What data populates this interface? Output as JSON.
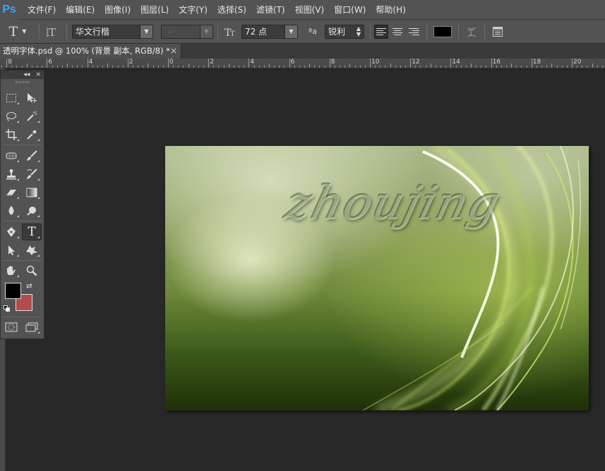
{
  "app": {
    "logo": "Ps"
  },
  "menu": [
    "文件(F)",
    "编辑(E)",
    "图像(I)",
    "图层(L)",
    "文字(Y)",
    "选择(S)",
    "滤镜(T)",
    "视图(V)",
    "窗口(W)",
    "帮助(H)"
  ],
  "options": {
    "tool_icon": "text-tool-icon",
    "font_family": "华文行楷",
    "font_style": "-",
    "font_size": "72 点",
    "aa_label": "ªa",
    "antialias": "锐利",
    "text_color": "#000000"
  },
  "document": {
    "tab_title": "透明字体.psd @ 100% (背景 副本, RGB/8) *",
    "close_glyph": "×"
  },
  "ruler": {
    "labels": [
      "8",
      "6",
      "4",
      "2",
      "0",
      "2",
      "4",
      "6",
      "8",
      "10",
      "12",
      "14",
      "16",
      "18",
      "20"
    ]
  },
  "toolbox": {
    "collapse_glyph": "◂◂",
    "close_glyph": "×",
    "foreground_color": "#000000",
    "background_color": "#b24b4b",
    "tools": [
      "rectangular-marquee",
      "move",
      "lasso",
      "magic-wand",
      "crop",
      "eyedropper",
      "spot-healing-brush",
      "brush",
      "clone-stamp",
      "history-brush",
      "eraser",
      "gradient",
      "blur",
      "dodge",
      "pen",
      "horizontal-type",
      "path-selection",
      "custom-shape",
      "hand",
      "zoom",
      "quick-mask",
      "screen-mode"
    ],
    "active_tool": "horizontal-type"
  },
  "canvas": {
    "text": "zhoujing"
  },
  "colors": {
    "accent": "#31a8ff",
    "panel": "#535353",
    "workspace": "#282828"
  }
}
